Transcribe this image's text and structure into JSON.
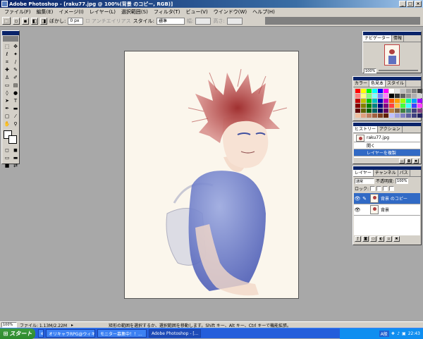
{
  "app": {
    "title": "Adobe Photoshop - [raku77.jpg @ 100%(背景 のコピー, RGB)]"
  },
  "menu": [
    "ファイル(F)",
    "編集(E)",
    "イメージ(I)",
    "レイヤー(L)",
    "選択範囲(S)",
    "フィルタ(T)",
    "ビュー(V)",
    "ウインドウ(W)",
    "ヘルプ(H)"
  ],
  "options": {
    "blur_label": "ぼかし:",
    "blur_value": "0 px",
    "antialias_label": "アンチエイリアス",
    "style_label": "スタイル:",
    "style_value": "標準",
    "width_label": "幅:",
    "height_label": "高さ:"
  },
  "navigator": {
    "tabs": [
      "ナビゲーター",
      "情報"
    ],
    "zoom": "100%"
  },
  "swatches": {
    "tabs": [
      "カラー",
      "色見本",
      "スタイル"
    ],
    "colors": [
      "#ff0000",
      "#ffff00",
      "#00ff00",
      "#00ffff",
      "#0000ff",
      "#ff00ff",
      "#ffffff",
      "#e0e0e0",
      "#c0c0c0",
      "#a0a0a0",
      "#808080",
      "#404040",
      "#ff8080",
      "#ffff80",
      "#80ff80",
      "#80ffff",
      "#8080ff",
      "#ff80ff",
      "#000000",
      "#303030",
      "#606060",
      "#909090",
      "#b0b0b0",
      "#d0d0d0",
      "#c00000",
      "#c0c000",
      "#00c000",
      "#00c0c0",
      "#0000c0",
      "#c000c0",
      "#ff6000",
      "#ffa000",
      "#a0ff00",
      "#00ffa0",
      "#00a0ff",
      "#a000ff",
      "#800000",
      "#808000",
      "#008000",
      "#008080",
      "#000080",
      "#800080",
      "#ff4040",
      "#ffc040",
      "#40ff40",
      "#40ffff",
      "#4040ff",
      "#ff40ff",
      "#600000",
      "#606000",
      "#006000",
      "#006060",
      "#000060",
      "#600060",
      "#c08040",
      "#806040",
      "#408040",
      "#408080",
      "#404080",
      "#804080",
      "#f0c0a0",
      "#e0a080",
      "#c08060",
      "#a06040",
      "#804020",
      "#602000",
      "#c0c0ff",
      "#a0a0e0",
      "#8080c0",
      "#6060a0",
      "#404080",
      "#202060"
    ]
  },
  "history": {
    "tabs": [
      "ヒストリー",
      "アクション"
    ],
    "file": "raku77.jpg",
    "items": [
      "開く",
      "レイヤーを複製"
    ]
  },
  "layers": {
    "tabs": [
      "レイヤー",
      "チャンネル",
      "パス"
    ],
    "mode": "通常",
    "opacity_label": "不透明度:",
    "opacity_value": "100%",
    "lock_label": "ロック:",
    "items": [
      {
        "name": "背景 のコピー",
        "selected": true
      },
      {
        "name": "背景",
        "selected": false
      }
    ]
  },
  "status": {
    "zoom": "100%",
    "file_info": "ファイル: 1.13M/2.22M",
    "hint": "矩形の範囲を選択するか、選択範囲を移動します。Shift キー、Alt キー、Ctrl キーで機能拡張。"
  },
  "taskbar": {
    "start": "スタート",
    "tasks": [
      {
        "label": "オリキャラRPG@ウィキ...",
        "active": false
      },
      {
        "label": "モニター募集中！！...",
        "active": false
      },
      {
        "label": "Adobe Photoshop - [...",
        "active": true
      }
    ],
    "lang": "A般",
    "time": "22:43"
  }
}
